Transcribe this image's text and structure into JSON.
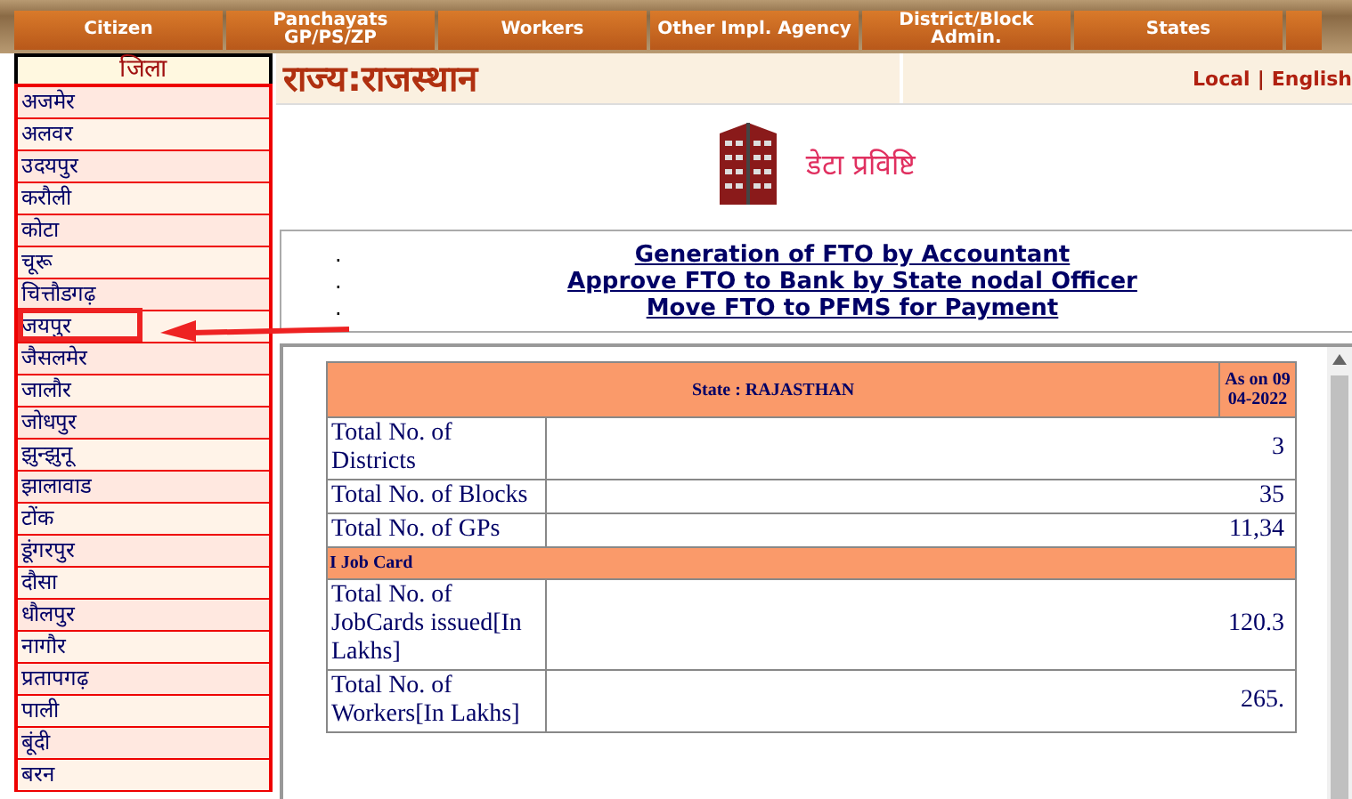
{
  "nav": {
    "items": [
      {
        "label": "Citizen"
      },
      {
        "label": "Panchayats GP/PS/ZP"
      },
      {
        "label": "Workers"
      },
      {
        "label": "Other Impl. Agency"
      },
      {
        "label": "District/Block Admin."
      },
      {
        "label": "States"
      }
    ]
  },
  "sidebar": {
    "heading": "जिला",
    "items": [
      {
        "label": "अजमेर",
        "highlighted": false
      },
      {
        "label": "अलवर",
        "highlighted": false
      },
      {
        "label": "उदयपुर",
        "highlighted": false
      },
      {
        "label": "करौली",
        "highlighted": false
      },
      {
        "label": "कोटा",
        "highlighted": false
      },
      {
        "label": "चूरू",
        "highlighted": false
      },
      {
        "label": "चित्तौडगढ़",
        "highlighted": false
      },
      {
        "label": "जयपुर",
        "highlighted": true
      },
      {
        "label": "जैसलमेर",
        "highlighted": false
      },
      {
        "label": "जालौर",
        "highlighted": false
      },
      {
        "label": "जोधपुर",
        "highlighted": false
      },
      {
        "label": "झुन्झुनू",
        "highlighted": false
      },
      {
        "label": "झालावाड",
        "highlighted": false
      },
      {
        "label": "टोंक",
        "highlighted": false
      },
      {
        "label": "डूंगरपुर",
        "highlighted": false
      },
      {
        "label": "दौसा",
        "highlighted": false
      },
      {
        "label": "धौलपुर",
        "highlighted": false
      },
      {
        "label": "नागौर",
        "highlighted": false
      },
      {
        "label": "प्रतापगढ़",
        "highlighted": false
      },
      {
        "label": "पाली",
        "highlighted": false
      },
      {
        "label": "बूंदी",
        "highlighted": false
      },
      {
        "label": "बरन",
        "highlighted": false
      }
    ]
  },
  "header": {
    "title": "राज्य:राजस्थान",
    "languages": [
      "Local",
      "English"
    ],
    "separator": "|"
  },
  "banner": {
    "title": "डेटा प्रविष्टि"
  },
  "links": [
    {
      "bullet": ".",
      "label": "Generation of FTO by Accountant"
    },
    {
      "bullet": ".",
      "label": "Approve FTO to Bank by State nodal Officer"
    },
    {
      "bullet": ".",
      "label": "Move FTO to PFMS for Payment"
    }
  ],
  "table": {
    "title": "State : RAJASTHAN",
    "date": "As on 09 04-2022",
    "rows": [
      {
        "kind": "data",
        "label": "Total No. of Districts",
        "value": "3"
      },
      {
        "kind": "data",
        "label": "Total No. of Blocks",
        "value": "35"
      },
      {
        "kind": "data",
        "label": "Total No. of GPs",
        "value": "11,34"
      },
      {
        "kind": "section",
        "label": "I Job Card"
      },
      {
        "kind": "data",
        "label": "Total No. of JobCards issued[In Lakhs]",
        "value": "120.3"
      },
      {
        "kind": "data",
        "label": "Total No. of Workers[In Lakhs]",
        "value": "265."
      }
    ]
  }
}
